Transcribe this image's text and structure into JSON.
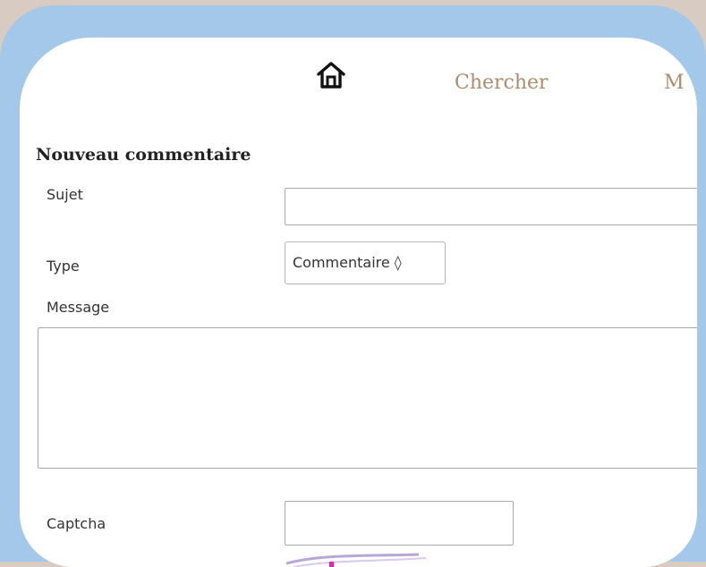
{
  "nav": {
    "home_icon": "home-icon",
    "search_label": "Chercher",
    "more_label_fragment": "M"
  },
  "form": {
    "title": "Nouveau commentaire",
    "subject_label": "Sujet",
    "subject_value": "",
    "type_label": "Type",
    "type_selected": "Commentaire ◊",
    "message_label": "Message",
    "message_value": "",
    "captcha_label": "Captcha",
    "captcha_value": ""
  },
  "colors": {
    "frame": "#a3c8ea",
    "background": "#d7cbc2",
    "nav_link": "#b08b6e"
  }
}
